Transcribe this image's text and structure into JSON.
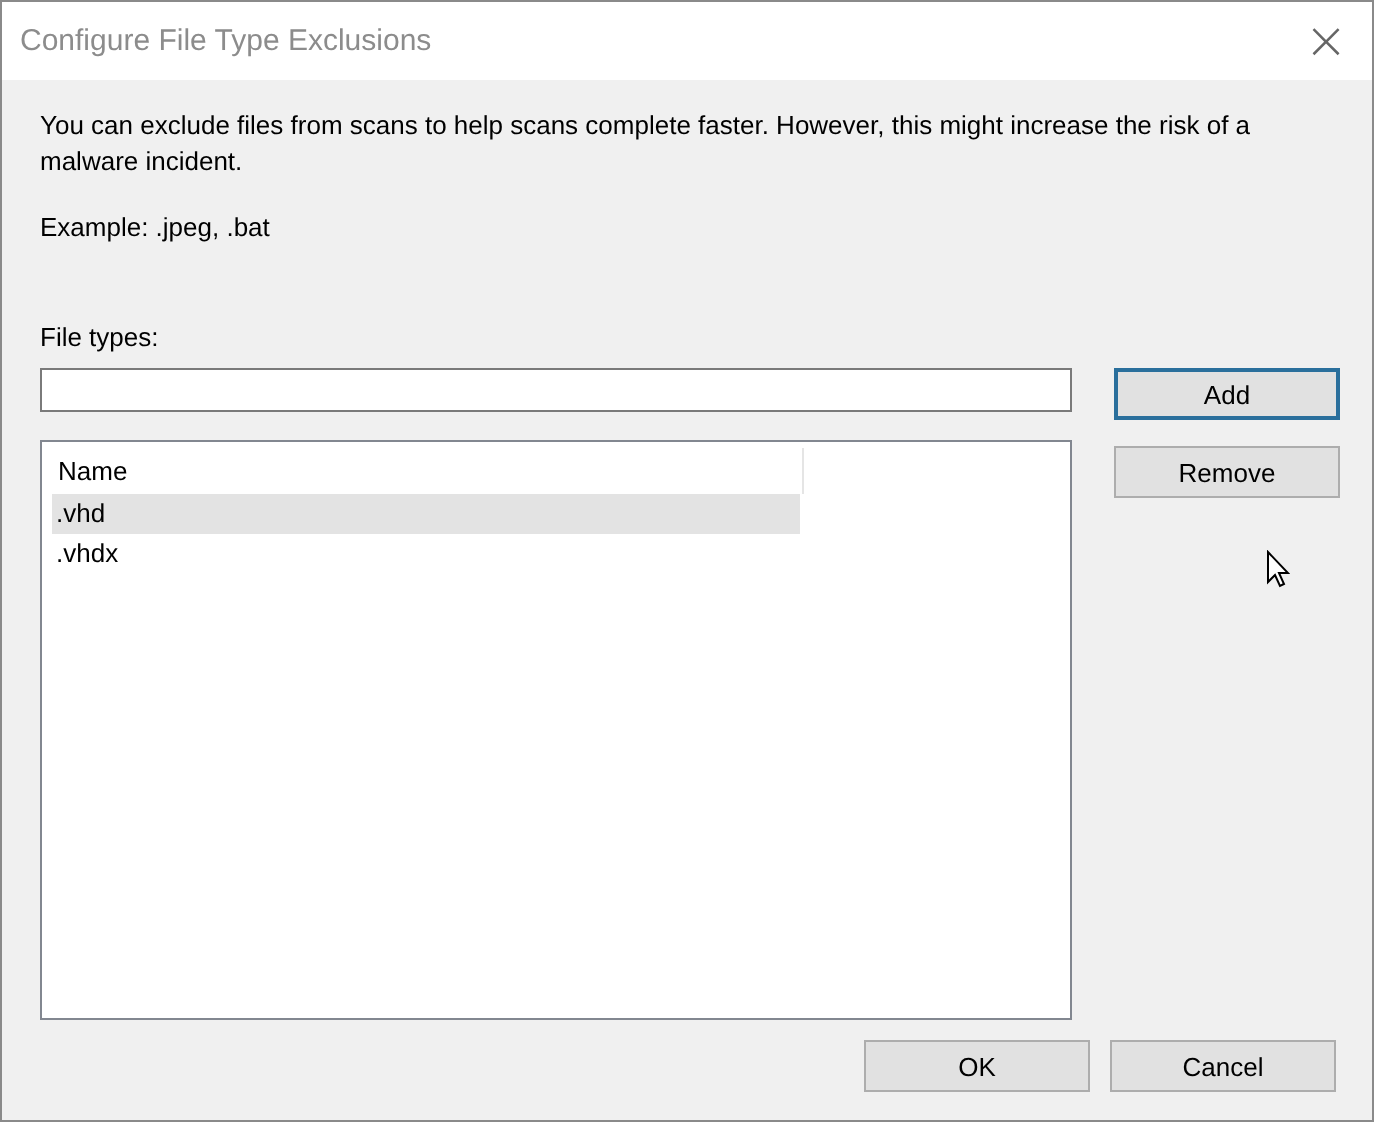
{
  "window": {
    "title": "Configure File Type Exclusions",
    "close": "×"
  },
  "description": "You can exclude files from scans to help scans complete faster. However, this might increase the risk of a malware incident.",
  "example": "Example: .jpeg, .bat",
  "field": {
    "label": "File types:"
  },
  "side_buttons": [
    {
      "label": "Add",
      "focused": true
    },
    {
      "label": "Remove",
      "focused": false
    }
  ],
  "list": {
    "columns": [
      "Name"
    ],
    "rows": [
      {
        "name": ".vhd",
        "selected": true
      },
      {
        "name": ".vhdx",
        "selected": false
      }
    ]
  },
  "buttons": [
    {
      "label": "OK",
      "focused": false
    },
    {
      "label": "Cancel",
      "focused": false
    }
  ]
}
